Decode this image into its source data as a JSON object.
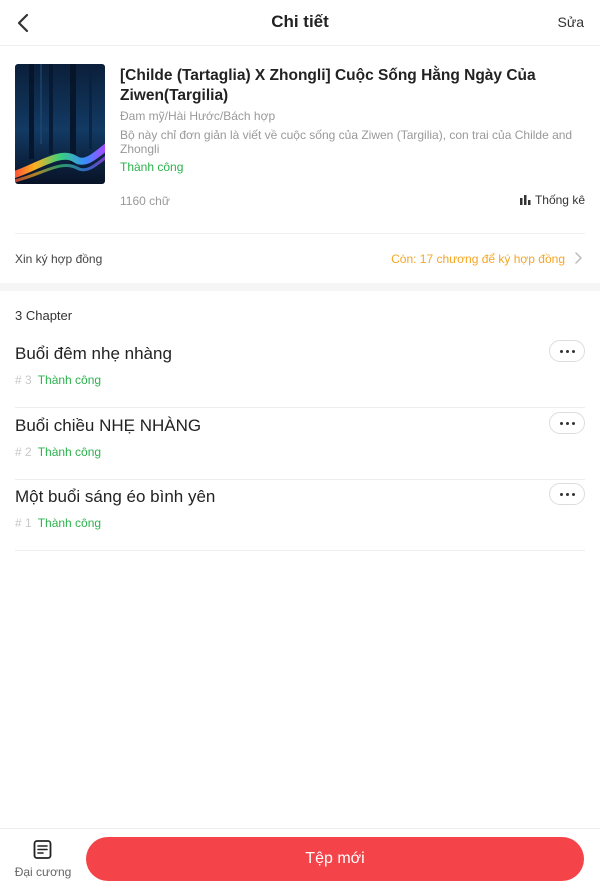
{
  "header": {
    "title": "Chi tiết",
    "edit_label": "Sửa"
  },
  "book": {
    "title": "[Childe (Tartaglia) X Zhongli] Cuộc Sống Hằng Ngày Của Ziwen(Targilia)",
    "genre": "Đam mỹ/Hài Hước/Bách hợp",
    "description": "Bộ này chỉ đơn giản là viết về cuộc sống của Ziwen (Targilia), con trai của Childe and Zhongli",
    "status": "Thành công",
    "word_count": "1160 chữ",
    "stats_label": "Thống kê"
  },
  "contract": {
    "label": "Xin ký hợp đồng",
    "remaining": "Còn: 17 chương để ký hợp đồng"
  },
  "chapters": {
    "count_label": "3 Chapter",
    "items": [
      {
        "title": "Buổi đêm nhẹ nhàng",
        "number": "# 3",
        "status": "Thành công"
      },
      {
        "title": "Buổi chiều NHẸ NHÀNG",
        "number": "# 2",
        "status": "Thành công"
      },
      {
        "title": "Một buổi sáng éo bình yên",
        "number": "# 1",
        "status": "Thành công"
      }
    ]
  },
  "bottom": {
    "outline_label": "Đại cương",
    "new_chapter_label": "Tệp mới"
  },
  "colors": {
    "accent": "#f4444a",
    "success": "#2bb24c",
    "warning": "#f5a623"
  },
  "icons": {
    "back": "back-arrow-icon",
    "stats": "bar-chart-icon",
    "chevron": "chevron-right-icon",
    "more": "more-dots-icon",
    "outline": "document-list-icon"
  }
}
